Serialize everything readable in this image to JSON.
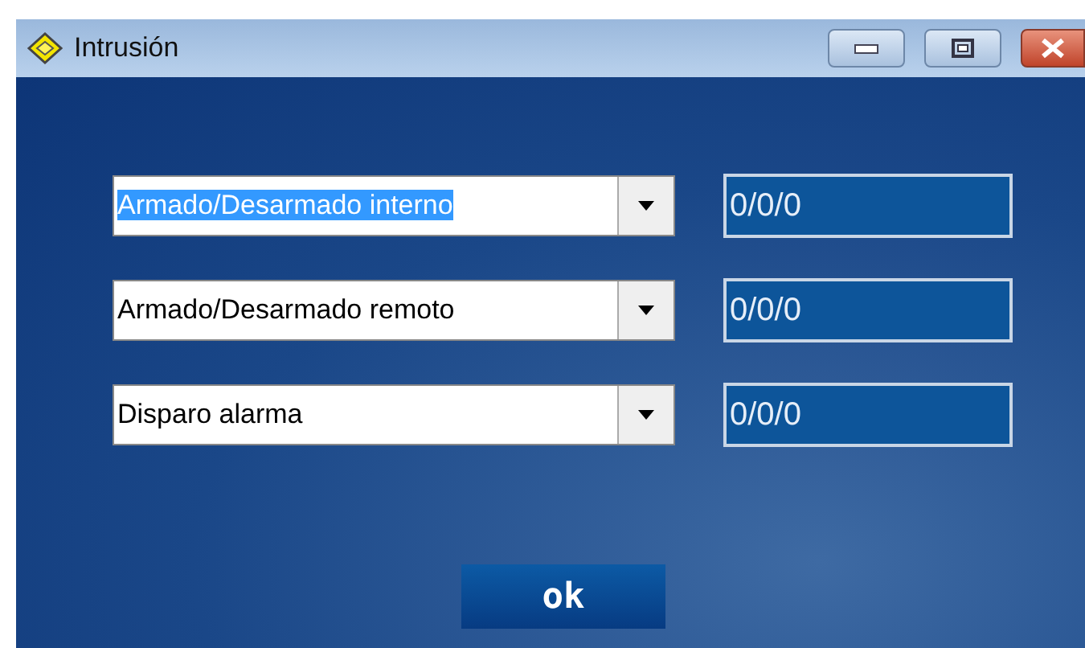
{
  "window": {
    "title": "Intrusión"
  },
  "rows": [
    {
      "option": "Armado/Desarmado interno",
      "highlighted": true,
      "value": "0/0/0"
    },
    {
      "option": "Armado/Desarmado remoto",
      "highlighted": false,
      "value": "0/0/0"
    },
    {
      "option": "Disparo alarma",
      "highlighted": false,
      "value": "0/0/0"
    }
  ],
  "buttons": [
    "ok"
  ]
}
